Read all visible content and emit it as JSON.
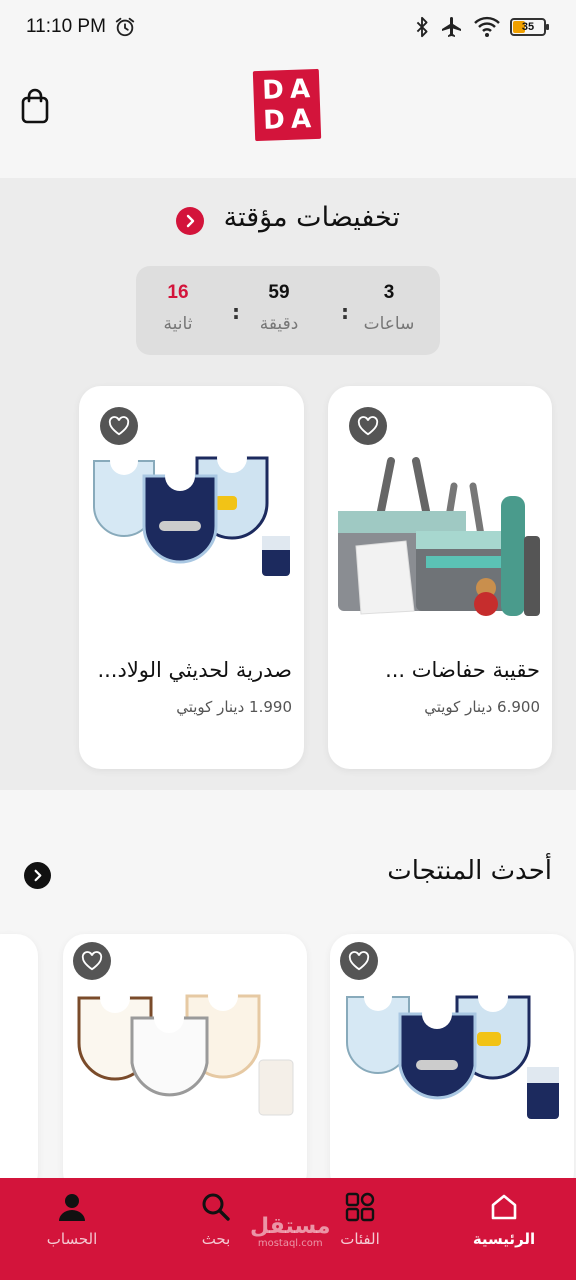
{
  "status_bar": {
    "time": "11:10 PM",
    "battery": "35"
  },
  "header": {
    "logo_letters": [
      "D",
      "A",
      "D",
      "A"
    ]
  },
  "flash_deals": {
    "title": "تخفيضات مؤقتة",
    "countdown": {
      "hours": {
        "value": "3",
        "label": "ساعات"
      },
      "minutes": {
        "value": "59",
        "label": "دقيقة"
      },
      "seconds": {
        "value": "16",
        "label": "ثانية"
      },
      "separator": ":"
    },
    "products": [
      {
        "name": "حقيبة حفاضات ...",
        "price": "6.900 دينار كويتي",
        "image": "diaper-bag-set"
      },
      {
        "name": "صدرية لحديثي الولاد...",
        "price": "1.990 دينار كويتي",
        "image": "vehicle-bibs-set"
      }
    ]
  },
  "latest": {
    "title": "أحدث المنتجات",
    "products": [
      {
        "image": "vehicle-bibs-set"
      },
      {
        "image": "safari-bibs-set"
      }
    ]
  },
  "bottom_nav": {
    "items": [
      {
        "label": "الرئيسية",
        "icon": "home-icon",
        "active": true
      },
      {
        "label": "الفئات",
        "icon": "grid-icon",
        "active": false
      },
      {
        "label": "بحث",
        "icon": "search-icon",
        "active": false
      },
      {
        "label": "الحساب",
        "icon": "user-icon",
        "active": false
      }
    ],
    "watermark": {
      "arabic": "مستقل",
      "domain": "mostaql.com"
    }
  },
  "colors": {
    "accent": "#d3143b",
    "background": "#f6f6f6",
    "section": "#ececec"
  }
}
